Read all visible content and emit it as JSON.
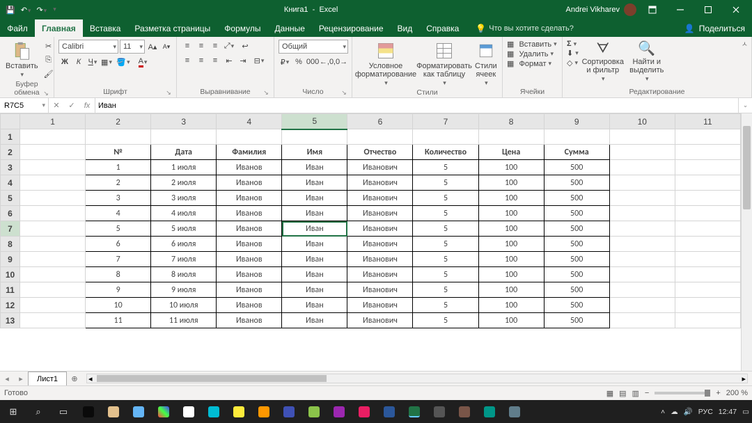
{
  "title": {
    "doc": "Книга1",
    "app": "Excel",
    "user": "Andrei Vikharev"
  },
  "tabs": {
    "file": "Файл",
    "items": [
      "Главная",
      "Вставка",
      "Разметка страницы",
      "Формулы",
      "Данные",
      "Рецензирование",
      "Вид",
      "Справка"
    ],
    "active_index": 0,
    "tell_me_placeholder": "Что вы хотите сделать?",
    "share": "Поделиться"
  },
  "groups": {
    "clipboard": {
      "paste": "Вставить",
      "label": "Буфер обмена"
    },
    "font": {
      "name": "Calibri",
      "size": "11",
      "label": "Шрифт"
    },
    "align": {
      "label": "Выравнивание"
    },
    "number": {
      "format": "Общий",
      "label": "Число"
    },
    "styles": {
      "cond": "Условное форматирование",
      "astable": "Форматировать как таблицу",
      "cellstyles": "Стили ячеек",
      "label": "Стили"
    },
    "cells": {
      "insert": "Вставить",
      "delete": "Удалить",
      "format": "Формат",
      "label": "Ячейки"
    },
    "editing": {
      "sort": "Сортировка и фильтр",
      "find": "Найти и выделить",
      "label": "Редактирование"
    }
  },
  "name_box": "R7C5",
  "formula_value": "Иван",
  "columns": [
    "1",
    "2",
    "3",
    "4",
    "5",
    "6",
    "7",
    "8",
    "9",
    "10",
    "11"
  ],
  "sel_col_index": 4,
  "sel_row_num": 7,
  "table": {
    "headers": [
      "№",
      "Дата",
      "Фамилия",
      "Имя",
      "Отчество",
      "Количество",
      "Цена",
      "Сумма"
    ],
    "rows": [
      [
        "1",
        "1 июля",
        "Иванов",
        "Иван",
        "Иванович",
        "5",
        "100",
        "500"
      ],
      [
        "2",
        "2 июля",
        "Иванов",
        "Иван",
        "Иванович",
        "5",
        "100",
        "500"
      ],
      [
        "3",
        "3 июля",
        "Иванов",
        "Иван",
        "Иванович",
        "5",
        "100",
        "500"
      ],
      [
        "4",
        "4 июля",
        "Иванов",
        "Иван",
        "Иванович",
        "5",
        "100",
        "500"
      ],
      [
        "5",
        "5 июля",
        "Иванов",
        "Иван",
        "Иванович",
        "5",
        "100",
        "500"
      ],
      [
        "6",
        "6 июля",
        "Иванов",
        "Иван",
        "Иванович",
        "5",
        "100",
        "500"
      ],
      [
        "7",
        "7 июля",
        "Иванов",
        "Иван",
        "Иванович",
        "5",
        "100",
        "500"
      ],
      [
        "8",
        "8 июля",
        "Иванов",
        "Иван",
        "Иванович",
        "5",
        "100",
        "500"
      ],
      [
        "9",
        "9 июля",
        "Иванов",
        "Иван",
        "Иванович",
        "5",
        "100",
        "500"
      ],
      [
        "10",
        "10 июля",
        "Иванов",
        "Иван",
        "Иванович",
        "5",
        "100",
        "500"
      ],
      [
        "11",
        "11 июля",
        "Иванов",
        "Иван",
        "Иванович",
        "5",
        "100",
        "500"
      ]
    ]
  },
  "sheet_tab": "Лист1",
  "status": {
    "ready": "Готово",
    "zoom": "200 %"
  },
  "tray": {
    "lang": "РУС",
    "time": "12:47"
  }
}
